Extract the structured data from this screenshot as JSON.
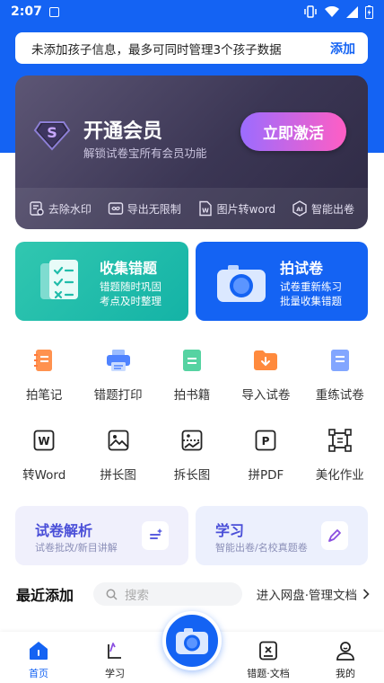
{
  "status": {
    "time": "2:07"
  },
  "notice": {
    "text": "未添加孩子信息，最多可同时管理3个孩子数据",
    "action": "添加"
  },
  "vip": {
    "title": "开通会员",
    "subtitle": "解锁试卷宝所有会员功能",
    "button": "立即激活",
    "perks": [
      "去除水印",
      "导出无限制",
      "图片转word",
      "智能出卷"
    ]
  },
  "cards": [
    {
      "title": "收集错题",
      "line1": "错题随时巩固",
      "line2": "考点及时整理"
    },
    {
      "title": "拍试卷",
      "line1": "试卷重新练习",
      "line2": "批量收集错题"
    }
  ],
  "tools_row1": [
    "拍笔记",
    "错题打印",
    "拍书籍",
    "导入试卷",
    "重练试卷"
  ],
  "tools_row2": [
    "转Word",
    "拼长图",
    "拆长图",
    "拼PDF",
    "美化作业"
  ],
  "panels": [
    {
      "title": "试卷解析",
      "subtitle": "试卷批改/新目讲解"
    },
    {
      "title": "学习",
      "subtitle": "智能出卷/名校真题卷"
    }
  ],
  "recent": {
    "title": "最近添加",
    "search_placeholder": "搜索",
    "link": "进入网盘·管理文档"
  },
  "tabs": [
    "首页",
    "学习",
    "错题·文档",
    "我的"
  ],
  "colors": {
    "brand": "#1463f3",
    "teal": "#20bcaa",
    "vip_bg": "#3b3654"
  }
}
